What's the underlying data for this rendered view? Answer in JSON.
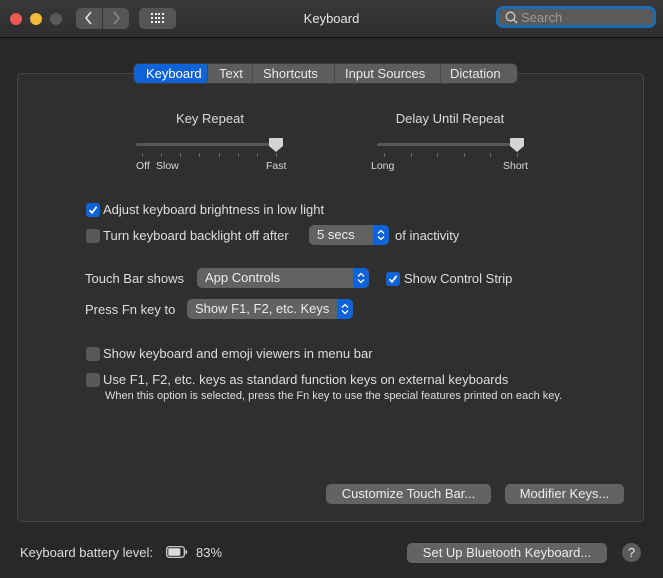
{
  "window": {
    "title": "Keyboard",
    "traffic_lights": [
      "close",
      "minimize",
      "zoom"
    ],
    "nav": {
      "back_icon": "chevron-left-icon",
      "forward_icon": "chevron-right-icon",
      "show_all_icon": "grid-icon"
    },
    "search": {
      "placeholder": "Search",
      "value": ""
    }
  },
  "tabs": [
    {
      "label": "Keyboard",
      "active": true
    },
    {
      "label": "Text",
      "active": false
    },
    {
      "label": "Shortcuts",
      "active": false
    },
    {
      "label": "Input Sources",
      "active": false
    },
    {
      "label": "Dictation",
      "active": false
    }
  ],
  "sliders": {
    "key_repeat": {
      "title": "Key Repeat",
      "labels": {
        "off": "Off",
        "slow": "Slow",
        "fast": "Fast"
      },
      "ticks": 8,
      "value_fraction": 1.0
    },
    "delay_until_repeat": {
      "title": "Delay Until Repeat",
      "labels": {
        "long": "Long",
        "short": "Short"
      },
      "ticks": 6,
      "value_fraction": 1.0
    }
  },
  "options": {
    "adjust_brightness": {
      "label": "Adjust keyboard brightness in low light",
      "checked": true
    },
    "backlight_off": {
      "label": "Turn keyboard backlight off after",
      "checked": false,
      "popup_value": "5 secs",
      "suffix": "of inactivity"
    },
    "touch_bar": {
      "label": "Touch Bar shows",
      "popup_value": "App Controls",
      "control_strip": {
        "label": "Show Control Strip",
        "checked": true
      }
    },
    "fn_key": {
      "label": "Press Fn key to",
      "popup_value": "Show F1, F2, etc. Keys"
    },
    "show_viewers": {
      "label": "Show keyboard and emoji viewers in menu bar",
      "checked": false
    },
    "standard_fn_keys": {
      "label": "Use F1, F2, etc. keys as standard function keys on external keyboards",
      "checked": false,
      "note": "When this option is selected, press the Fn key to use the special features printed on each key."
    }
  },
  "buttons": {
    "customize_touch_bar": "Customize Touch Bar...",
    "modifier_keys": "Modifier Keys...",
    "setup_bluetooth": "Set Up Bluetooth Keyboard...",
    "help": "?"
  },
  "footer": {
    "battery_label": "Keyboard battery level:",
    "battery_value": "83%",
    "battery_fraction": 0.83
  },
  "colors": {
    "accent": "#0e63d8",
    "background": "#282828",
    "panel": "#2f2f2f",
    "close": "#ee5a52",
    "minimize": "#f3b93a"
  }
}
